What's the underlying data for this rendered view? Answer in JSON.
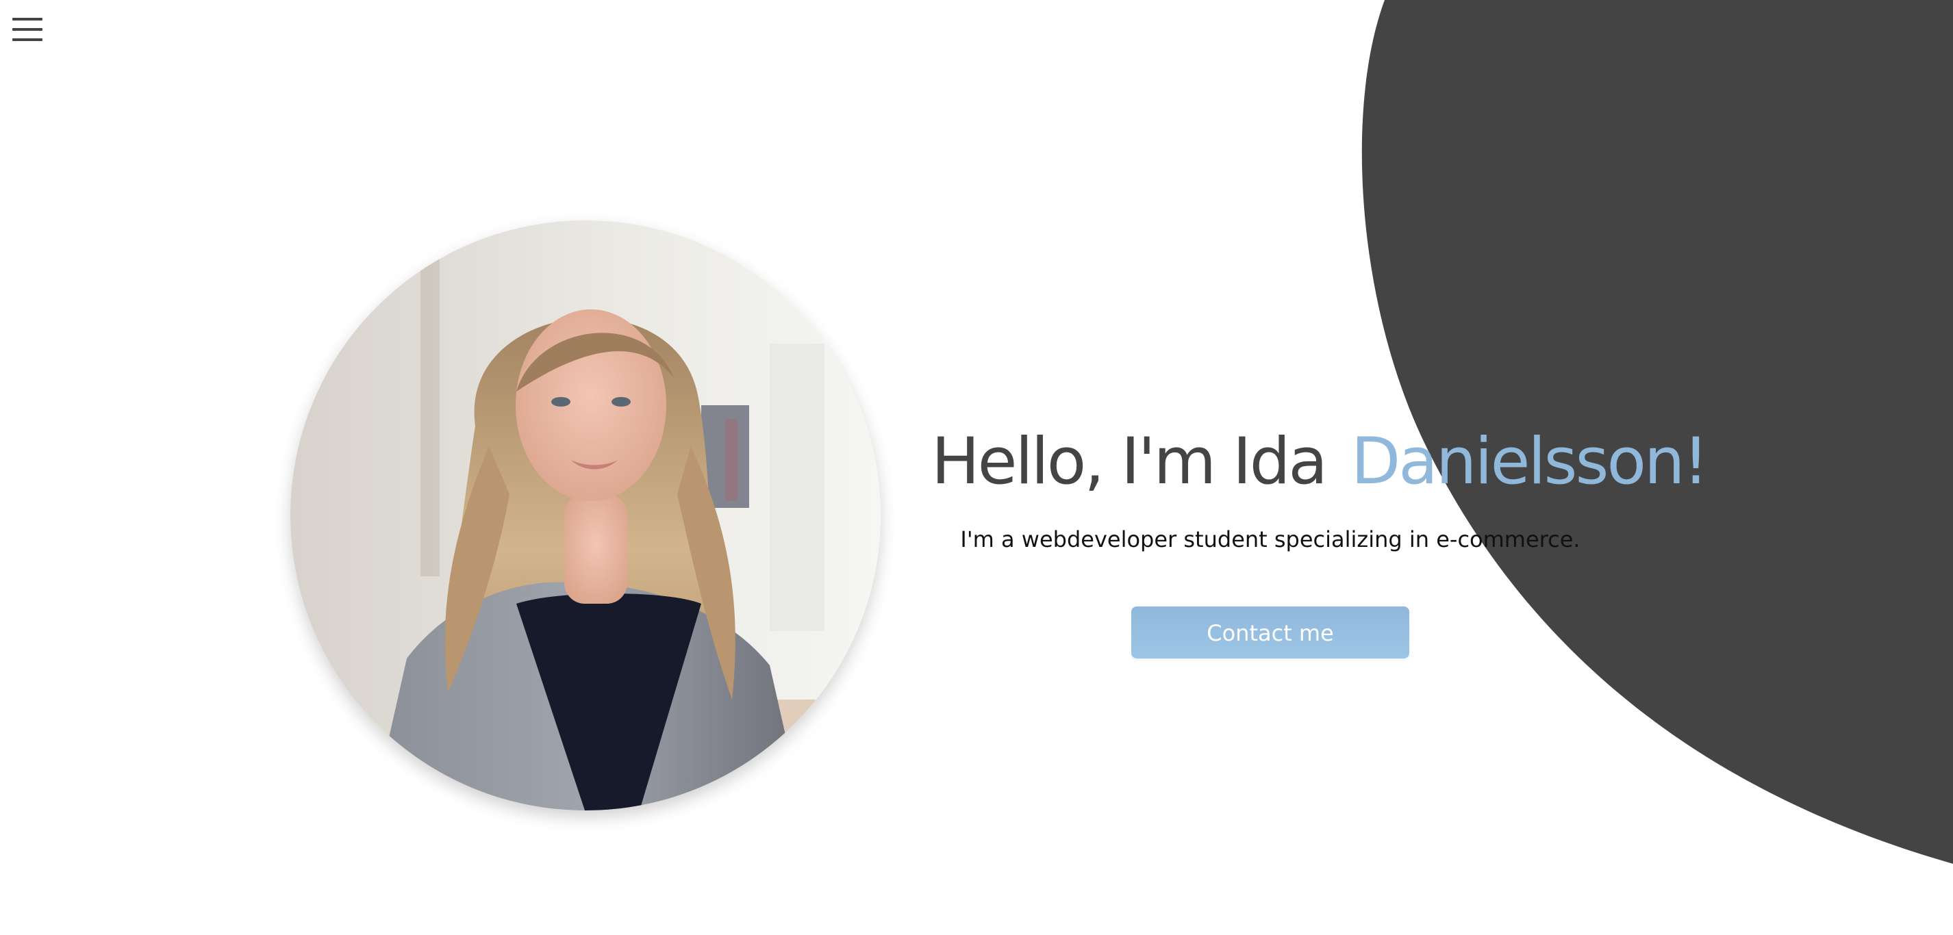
{
  "nav": {
    "menu_icon": "hamburger-menu-icon"
  },
  "hero": {
    "title_main": "Hello, I'm Ida",
    "title_accent": "Danielsson!",
    "subtitle": "I'm a webdeveloper student specializing in e-commerce.",
    "contact_label": "Contact me"
  },
  "colors": {
    "background": "#ffffff",
    "blob": "#444444",
    "heading": "#444444",
    "accent": "#8fb8db",
    "button_text": "#ffffff"
  }
}
